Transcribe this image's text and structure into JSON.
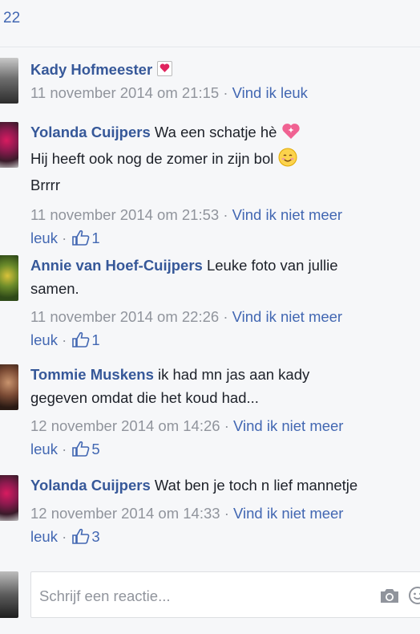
{
  "top_count": "22",
  "comments": [
    {
      "author": "Kady Hofmeester",
      "text_lines": [],
      "badge": "heart-badge",
      "timestamp": "11 november 2014 om 21:15",
      "action": "Vind ik leuk",
      "likes": null
    },
    {
      "author": "Yolanda Cuijpers",
      "first": "Wa een schatje hè",
      "line2": "Hij heeft ook nog de zomer in zijn bol",
      "line3": "Brrrr",
      "timestamp": "11 november 2014 om 21:53",
      "action_part1": "Vind ik niet meer",
      "action_part2": "leuk",
      "likes": "1"
    },
    {
      "author": "Annie van Hoef-Cuijpers",
      "first": "Leuke foto van jullie",
      "line2": "samen.",
      "timestamp": "11 november 2014 om 22:26",
      "action_part1": "Vind ik niet meer",
      "action_part2": "leuk",
      "likes": "1"
    },
    {
      "author": "Tommie Muskens",
      "first": "ik had mn jas aan kady",
      "line2": "gegeven omdat die het koud had...",
      "timestamp": "12 november 2014 om 14:26",
      "action_part1": "Vind ik niet meer",
      "action_part2": "leuk",
      "likes": "5"
    },
    {
      "author": "Yolanda Cuijpers",
      "first": "Wat ben je toch n lief mannetje",
      "timestamp": "12 november 2014 om 14:33",
      "action_part1": "Vind ik niet meer",
      "action_part2": "leuk",
      "likes": "3"
    }
  ],
  "composer": {
    "placeholder": "Schrijf een reactie..."
  },
  "separator": " · ",
  "colors": {
    "link": "#4267b2",
    "author": "#365899",
    "meta": "#90949c"
  }
}
